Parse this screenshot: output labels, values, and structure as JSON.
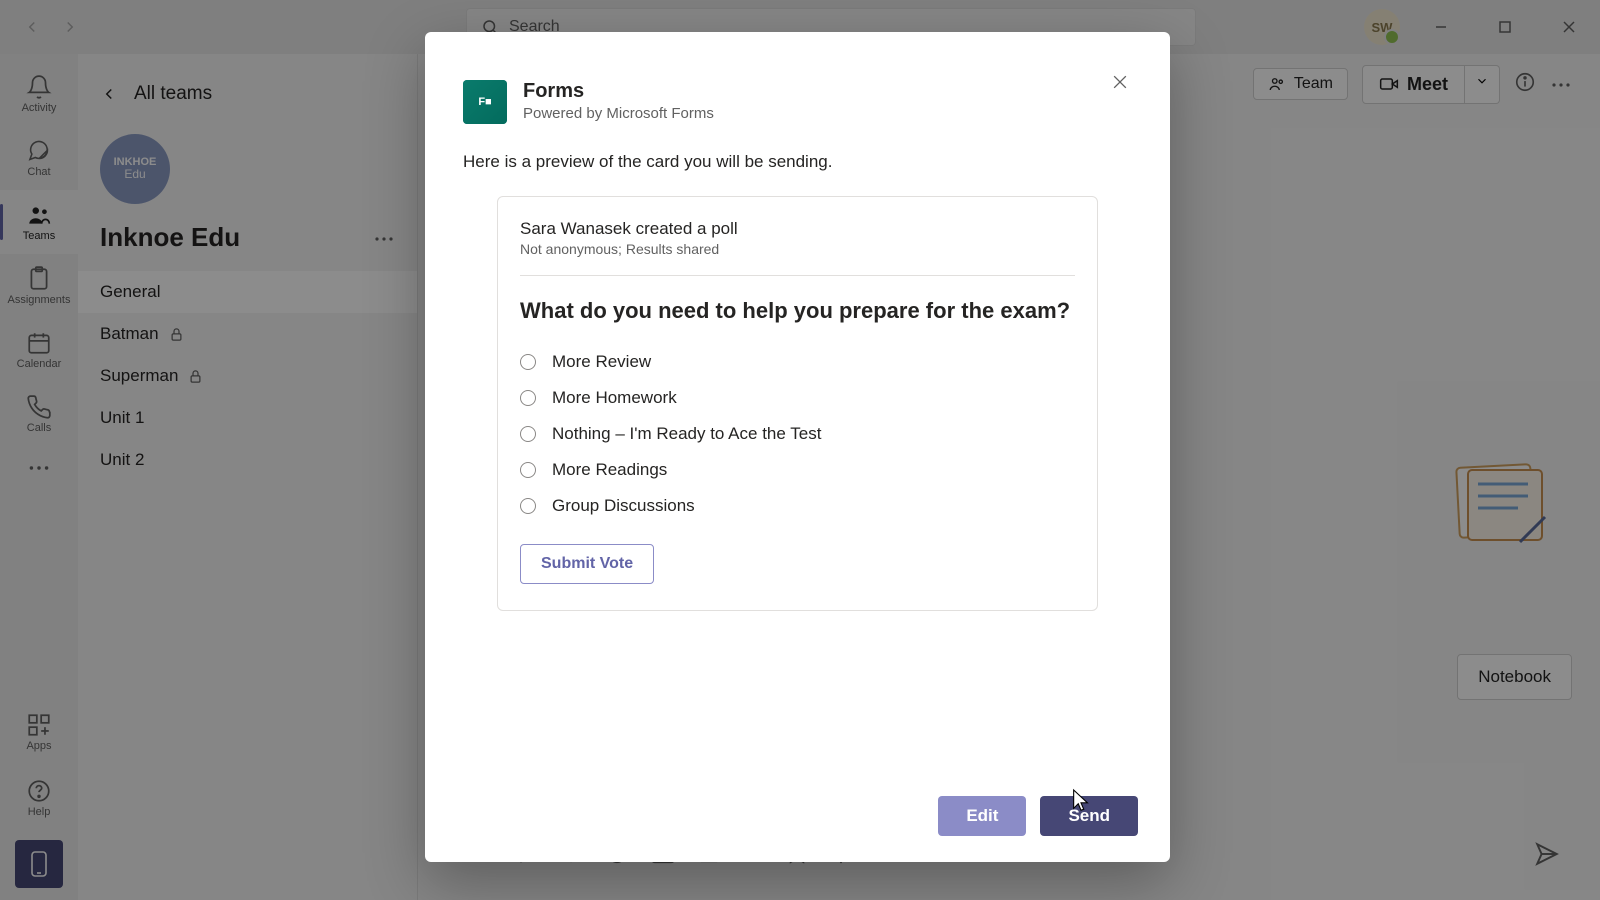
{
  "titlebar": {
    "search_placeholder": "Search",
    "avatar_initials": "SW"
  },
  "leftrail": {
    "items": [
      {
        "label": "Activity"
      },
      {
        "label": "Chat"
      },
      {
        "label": "Teams"
      },
      {
        "label": "Assignments"
      },
      {
        "label": "Calendar"
      },
      {
        "label": "Calls"
      }
    ],
    "apps_label": "Apps",
    "help_label": "Help"
  },
  "sidebar": {
    "all_teams": "All teams",
    "team_avatar_line1": "INKHOE",
    "team_avatar_line2": "Edu",
    "team_name": "Inknoe Edu",
    "channels": [
      {
        "label": "General",
        "locked": false
      },
      {
        "label": "Batman",
        "locked": true
      },
      {
        "label": "Superman",
        "locked": true
      },
      {
        "label": "Unit 1",
        "locked": false
      },
      {
        "label": "Unit 2",
        "locked": false
      }
    ]
  },
  "header": {
    "team_btn": "Team",
    "meet_btn": "Meet",
    "notebook_btn": "Notebook"
  },
  "modal": {
    "app_name": "Forms",
    "powered_by": "Powered by Microsoft Forms",
    "intro": "Here is a preview of the card you will be sending.",
    "creator_line": "Sara Wanasek created a poll",
    "meta_line": "Not anonymous; Results shared",
    "question": "What do you need to help you prepare for the exam?",
    "options": [
      "More Review",
      "More Homework",
      "Nothing – I'm Ready to Ace the Test",
      "More Readings",
      "Group Discussions"
    ],
    "submit_label": "Submit Vote",
    "edit_label": "Edit",
    "send_label": "Send"
  }
}
